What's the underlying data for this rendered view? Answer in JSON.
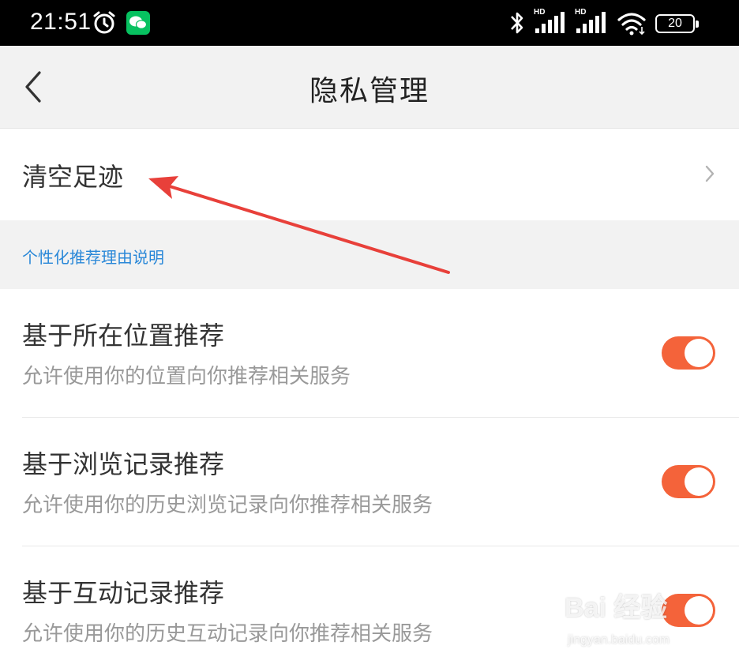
{
  "status_bar": {
    "time": "21:51",
    "signal_label": "HD",
    "battery": "20"
  },
  "header": {
    "title": "隐私管理"
  },
  "clear_history": {
    "label": "清空足迹"
  },
  "section": {
    "link": "个性化推荐理由说明"
  },
  "settings": [
    {
      "title": "基于所在位置推荐",
      "desc": "允许使用你的位置向你推荐相关服务",
      "enabled": true
    },
    {
      "title": "基于浏览记录推荐",
      "desc": "允许使用你的历史浏览记录向你推荐相关服务",
      "enabled": true
    },
    {
      "title": "基于互动记录推荐",
      "desc": "允许使用你的历史互动记录向你推荐相关服务",
      "enabled": true
    }
  ],
  "watermark": {
    "brand": "Bai 经验",
    "url": "jingyan.baidu.com"
  },
  "colors": {
    "toggle_on": "#f4633a",
    "link": "#2a88d8",
    "annotation_arrow": "#e8403a"
  }
}
